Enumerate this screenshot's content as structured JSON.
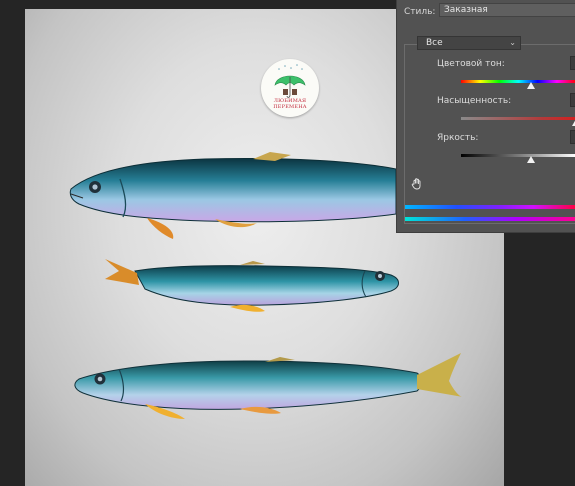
{
  "logo": {
    "caption_line1": "ЛЮБИМАЯ",
    "caption_line2": "ПЕРЕМЕНА"
  },
  "panel": {
    "style_label": "Стиль:",
    "style_value": "Заказная",
    "range_value": "Все",
    "hue_label": "Цветовой тон:",
    "saturation_label": "Насыщенность:",
    "brightness_label": "Яркость:"
  },
  "sliders": {
    "hue": 0.61,
    "saturation": 1.0,
    "brightness": 0.61
  },
  "colors": {
    "canvas_bg": "#dedede",
    "workspace_bg": "#252525",
    "panel_bg": "#525252",
    "fish_body": "#2f8aa0",
    "fish_back": "#0c3945",
    "logo_umbrella": "#3cc06a",
    "logo_text": "#c2283a"
  },
  "icons": {
    "hand_tool": "hand-icon",
    "dropdown": "chevron-down-icon"
  }
}
